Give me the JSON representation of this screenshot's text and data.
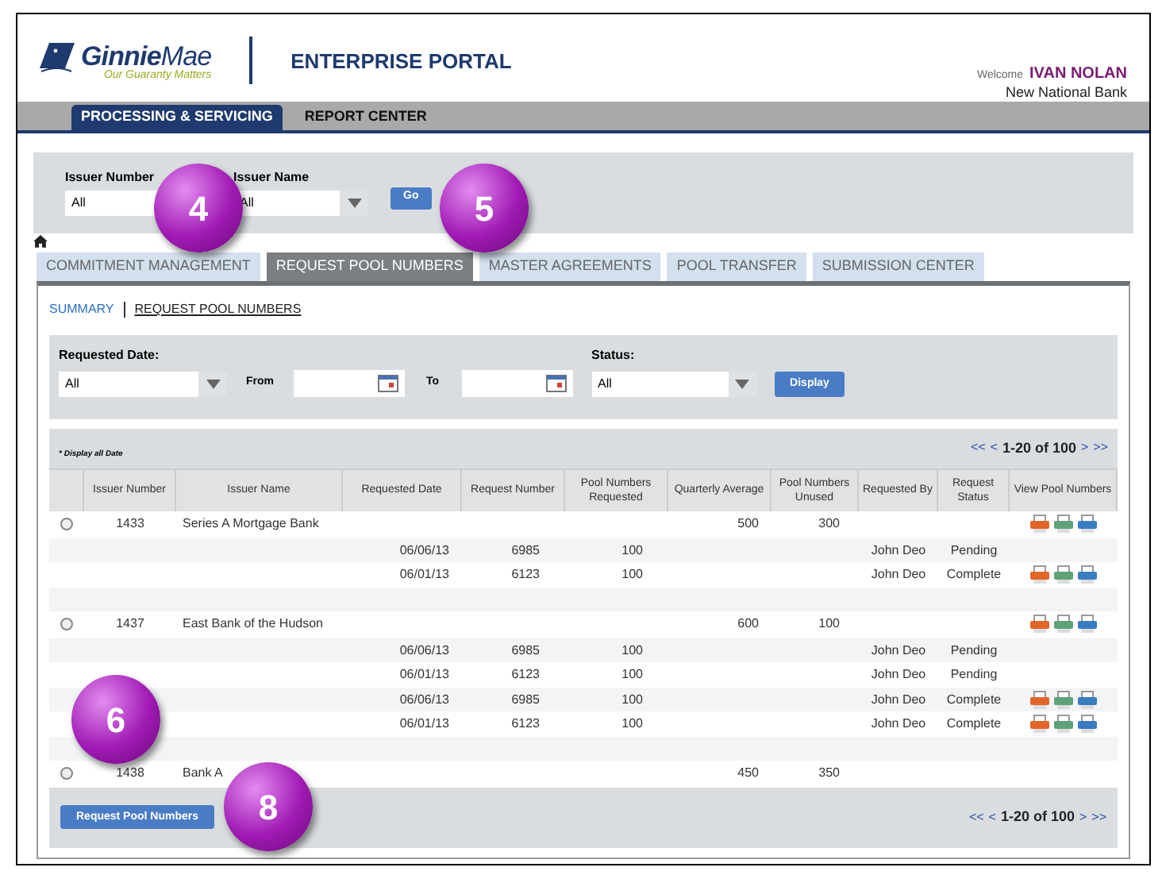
{
  "header": {
    "logo_word_1": "Ginnie",
    "logo_word_2": "Mae",
    "tagline": "Our Guaranty Matters",
    "portal_title": "ENTERPRISE PORTAL",
    "welcome": "Welcome",
    "user": "IVAN NOLAN",
    "bank": "New National Bank"
  },
  "nav": [
    {
      "label": "PROCESSING & SERVICING",
      "selected": true
    },
    {
      "label": "REPORT CENTER",
      "selected": false
    }
  ],
  "issuer_filter": {
    "issuer_number_label": "Issuer Number",
    "issuer_number_value": "All",
    "issuer_name_label": "Issuer Name",
    "issuer_name_value": "All",
    "go": "Go"
  },
  "tabs": [
    {
      "label": "COMMITMENT MANAGEMENT",
      "selected": false
    },
    {
      "label": "REQUEST POOL NUMBERS",
      "selected": true
    },
    {
      "label": "MASTER AGREEMENTS",
      "selected": false
    },
    {
      "label": "POOL TRANSFER",
      "selected": false
    },
    {
      "label": "SUBMISSION CENTER",
      "selected": false
    }
  ],
  "subnav": [
    {
      "label": "SUMMARY",
      "selected": false
    },
    {
      "label": "REQUEST POOL NUMBERS",
      "selected": true
    }
  ],
  "filters": {
    "requested_date_label": "Requested Date:",
    "requested_date_value": "All",
    "from_label": "From",
    "to_label": "To",
    "status_label": "Status:",
    "status_value": "All",
    "display": "Display"
  },
  "table": {
    "note": "* Display all Date",
    "pagination": {
      "first": "<<",
      "prev": "<",
      "range": "1-20 of 100",
      "next": ">",
      "last": ">>"
    },
    "columns": [
      "Issuer Number",
      "Issuer Name",
      "Requested Date",
      "Request Number",
      "Pool Numbers Requested",
      "Quarterly Average",
      "Pool Numbers Unused",
      "Requested By",
      "Request Status",
      "View Pool Numbers"
    ],
    "rows": [
      {
        "kind": "issuer",
        "selected": false,
        "number": "1433",
        "name": "Series A Mortgage Bank",
        "average": "500",
        "unused": "300",
        "icons": true
      },
      {
        "kind": "request",
        "date": "06/06/13",
        "request_number": "6985",
        "requested": "100",
        "by": "John Deo",
        "status": "Pending",
        "icons": false
      },
      {
        "kind": "request",
        "date": "06/01/13",
        "request_number": "6123",
        "requested": "100",
        "by": "John Deo",
        "status": "Complete",
        "icons": true
      },
      {
        "kind": "spacer"
      },
      {
        "kind": "issuer",
        "selected": false,
        "number": "1437",
        "name": "East Bank of the Hudson",
        "average": "600",
        "unused": "100",
        "icons": true
      },
      {
        "kind": "request",
        "date": "06/06/13",
        "request_number": "6985",
        "requested": "100",
        "by": "John Deo",
        "status": "Pending",
        "icons": false
      },
      {
        "kind": "request",
        "date": "06/01/13",
        "request_number": "6123",
        "requested": "100",
        "by": "John Deo",
        "status": "Pending",
        "icons": false
      },
      {
        "kind": "request",
        "date": "06/06/13",
        "request_number": "6985",
        "requested": "100",
        "by": "John Deo",
        "status": "Complete",
        "icons": true
      },
      {
        "kind": "request",
        "date": "06/01/13",
        "request_number": "6123",
        "requested": "100",
        "by": "John Deo",
        "status": "Complete",
        "icons": true
      },
      {
        "kind": "spacer"
      },
      {
        "kind": "issuer",
        "selected": false,
        "number": "1438",
        "name": "Bank A",
        "average": "450",
        "unused": "350",
        "icons": false
      }
    ]
  },
  "footer": {
    "button": "Request Pool Numbers",
    "pagination": {
      "first": "<<",
      "prev": "<",
      "range": "1-20 of 100",
      "next": ">",
      "last": ">>"
    }
  },
  "callouts": [
    "4",
    "5",
    "6",
    "8"
  ]
}
